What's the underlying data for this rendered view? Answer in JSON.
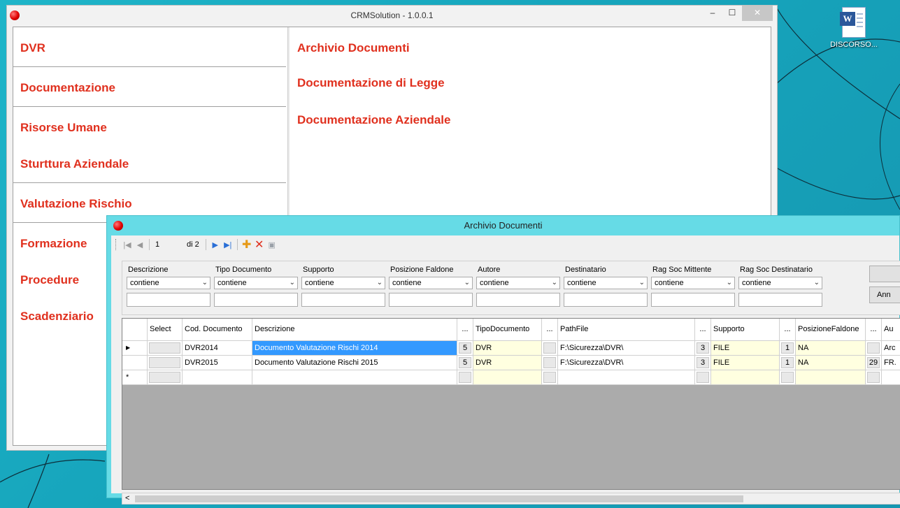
{
  "desktop": {
    "icon_label": "DISCORSO..."
  },
  "main_window": {
    "title": "CRMSolution - 1.0.0.1",
    "controls": {
      "minimize": "–",
      "maximize": "☐",
      "close": "✕"
    },
    "menu": [
      "DVR",
      "Documentazione",
      "Risorse Umane",
      "Sturttura Aziendale",
      "Valutazione Rischio",
      "Formazione",
      "Procedure",
      "Scadenziario"
    ],
    "submenu": [
      "Archivio Documenti",
      "Documentazione di Legge",
      "Documentazione Aziendale"
    ]
  },
  "archive_window": {
    "title": "Archivio Documenti",
    "navigator": {
      "position": "1",
      "count_label": "di 2"
    },
    "filters": [
      {
        "label": "Descrizione",
        "operator": "contiene"
      },
      {
        "label": "Tipo Documento",
        "operator": "contiene"
      },
      {
        "label": "Supporto",
        "operator": "contiene"
      },
      {
        "label": "Posizione Faldone",
        "operator": "contiene"
      },
      {
        "label": "Autore",
        "operator": "contiene"
      },
      {
        "label": "Destinatario",
        "operator": "contiene"
      },
      {
        "label": "Rag Soc Mittente",
        "operator": "contiene"
      },
      {
        "label": "Rag Soc Destinatario",
        "operator": "contiene"
      }
    ],
    "side_buttons": [
      "",
      "Ann"
    ],
    "grid": {
      "headers": [
        "Select",
        "Cod. Documento",
        "Descrizione",
        "...",
        "TipoDocumento",
        "...",
        "PathFile",
        "...",
        "Supporto",
        "...",
        "PosizioneFaldone",
        "...",
        "Au"
      ],
      "rows": [
        {
          "cod": "DVR2014",
          "descrizione": "Documento Valutazione Rischi 2014",
          "tipo_id": "5",
          "tipo": "DVR",
          "path": "F:\\Sicurezza\\DVR\\",
          "supp_id": "3",
          "supporto": "FILE",
          "pos_id": "1",
          "posizione": "NA",
          "aut_id": "",
          "autore": "Arc"
        },
        {
          "cod": "DVR2015",
          "descrizione": "Documento Valutazione Rischi 2015",
          "tipo_id": "5",
          "tipo": "DVR",
          "path": "F:\\Sicurezza\\DVR\\",
          "supp_id": "3",
          "supporto": "FILE",
          "pos_id": "1",
          "posizione": "NA",
          "aut_id": "29",
          "autore": "FR."
        }
      ],
      "current_row_marker": "▶",
      "new_row_marker": "*"
    },
    "scroll_left": "<"
  }
}
